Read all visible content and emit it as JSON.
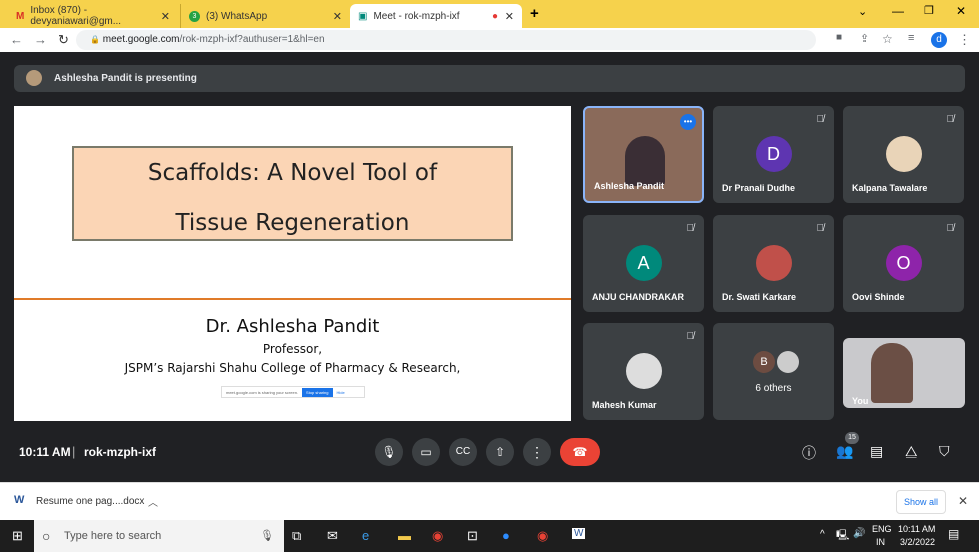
{
  "browser": {
    "tabs": [
      {
        "label": "Inbox (870) - devyaniawari@gm..."
      },
      {
        "label": "(3) WhatsApp"
      },
      {
        "label": "Meet - rok-mzph-ixf"
      }
    ],
    "url_host": "meet.google.com",
    "url_path": "/rok-mzph-ixf?authuser=1&hl=en",
    "profile": "d"
  },
  "banner": {
    "text": "Ashlesha Pandit is presenting"
  },
  "slide": {
    "title1": "Scaffolds: A Novel Tool of",
    "title2": "Tissue Regeneration",
    "name": "Dr. Ashlesha Pandit",
    "role": "Professor,",
    "college": "JSPM’s Rajarshi Shahu College of Pharmacy & Research,",
    "share_text": "meet.google.com is sharing your screen.",
    "stop": "Stop sharing",
    "hide": "Hide"
  },
  "participants": [
    {
      "name": "Ashlesha Pandit"
    },
    {
      "name": "Dr Pranali Dudhe",
      "initial": "D",
      "color": "#5e35b1"
    },
    {
      "name": "Kalpana Tawalare"
    },
    {
      "name": "ANJU CHANDRAKAR",
      "initial": "A",
      "color": "#00897b"
    },
    {
      "name": "Dr. Swati Karkare"
    },
    {
      "name": "Oovi Shinde",
      "initial": "O",
      "color": "#8e24aa"
    },
    {
      "name": "Mahesh Kumar"
    },
    {
      "name": "6 others",
      "initial": "B"
    },
    {
      "name": "You"
    }
  ],
  "bottom": {
    "time": "10:11 AM",
    "code": "rok-mzph-ixf",
    "people_count": "15"
  },
  "downloads": {
    "file": "Resume one pag....docx",
    "show_all": "Show all"
  },
  "taskbar": {
    "search": "Type here to search",
    "lang1": "ENG",
    "lang2": "IN",
    "time": "10:11 AM",
    "date": "3/2/2022"
  }
}
